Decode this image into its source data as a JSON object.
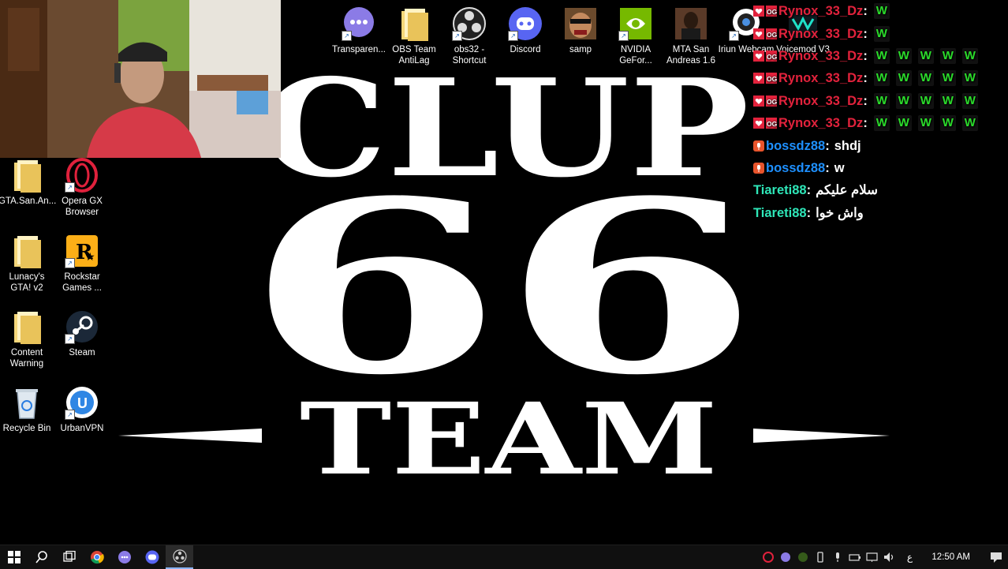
{
  "wallpaper": {
    "line1": "CLUP",
    "line2": "66",
    "line3": "TEAM"
  },
  "top_icons": [
    {
      "label": "Transparen...",
      "icon": "chat-bubble-icon"
    },
    {
      "label": "OBS Team AntiLag",
      "icon": "folder-icon"
    },
    {
      "label": "obs32 - Shortcut",
      "icon": "obs-icon"
    },
    {
      "label": "Discord",
      "icon": "discord-icon"
    },
    {
      "label": "samp",
      "icon": "samp-icon"
    },
    {
      "label": "NVIDIA GeFor...",
      "icon": "nvidia-icon"
    },
    {
      "label": "MTA San Andreas 1.6",
      "icon": "mta-icon"
    },
    {
      "label": "Iriun Webcam",
      "icon": "webcam-icon"
    },
    {
      "label": "Voicemod V3",
      "icon": "voicemod-icon"
    }
  ],
  "left_icons": [
    {
      "label": "GTA.San.An...",
      "icon": "folder-icon"
    },
    {
      "label": "Opera GX Browser",
      "icon": "opera-gx-icon"
    },
    {
      "label": "Lunacy's GTA! v2",
      "icon": "folder-icon"
    },
    {
      "label": "Rockstar Games ...",
      "icon": "rockstar-icon"
    },
    {
      "label": "Content Warning",
      "icon": "folder-icon"
    },
    {
      "label": "Steam",
      "icon": "steam-icon"
    },
    {
      "label": "Recycle Bin",
      "icon": "recycle-bin-icon"
    },
    {
      "label": "UrbanVPN",
      "icon": "urbanvpn-icon"
    }
  ],
  "chat": {
    "emote_text": "W",
    "messages": [
      {
        "user": "Rynox_33_Dz",
        "text": "",
        "w_count": 1
      },
      {
        "user": "Rynox_33_Dz",
        "text": "",
        "w_count": 1
      },
      {
        "user": "Rynox_33_Dz",
        "text": "",
        "w_count": 5
      },
      {
        "user": "Rynox_33_Dz",
        "text": "",
        "w_count": 5
      },
      {
        "user": "Rynox_33_Dz",
        "text": "",
        "w_count": 5
      },
      {
        "user": "Rynox_33_Dz",
        "text": "",
        "w_count": 5
      },
      {
        "user": "bossdz88",
        "text": "shdj"
      },
      {
        "user": "bossdz88",
        "text": "w"
      },
      {
        "user": "Tiareti88",
        "text": "سلام عليكم"
      },
      {
        "user": "Tiareti88",
        "text": "واش خوا"
      }
    ]
  },
  "taskbar": {
    "lang": "ع",
    "time": "12:50 AM"
  },
  "colors": {
    "rynox": "#e2223c",
    "bossdz": "#1e90ff",
    "tiareti": "#2ee6b8",
    "emote": "#2bdc2b"
  }
}
